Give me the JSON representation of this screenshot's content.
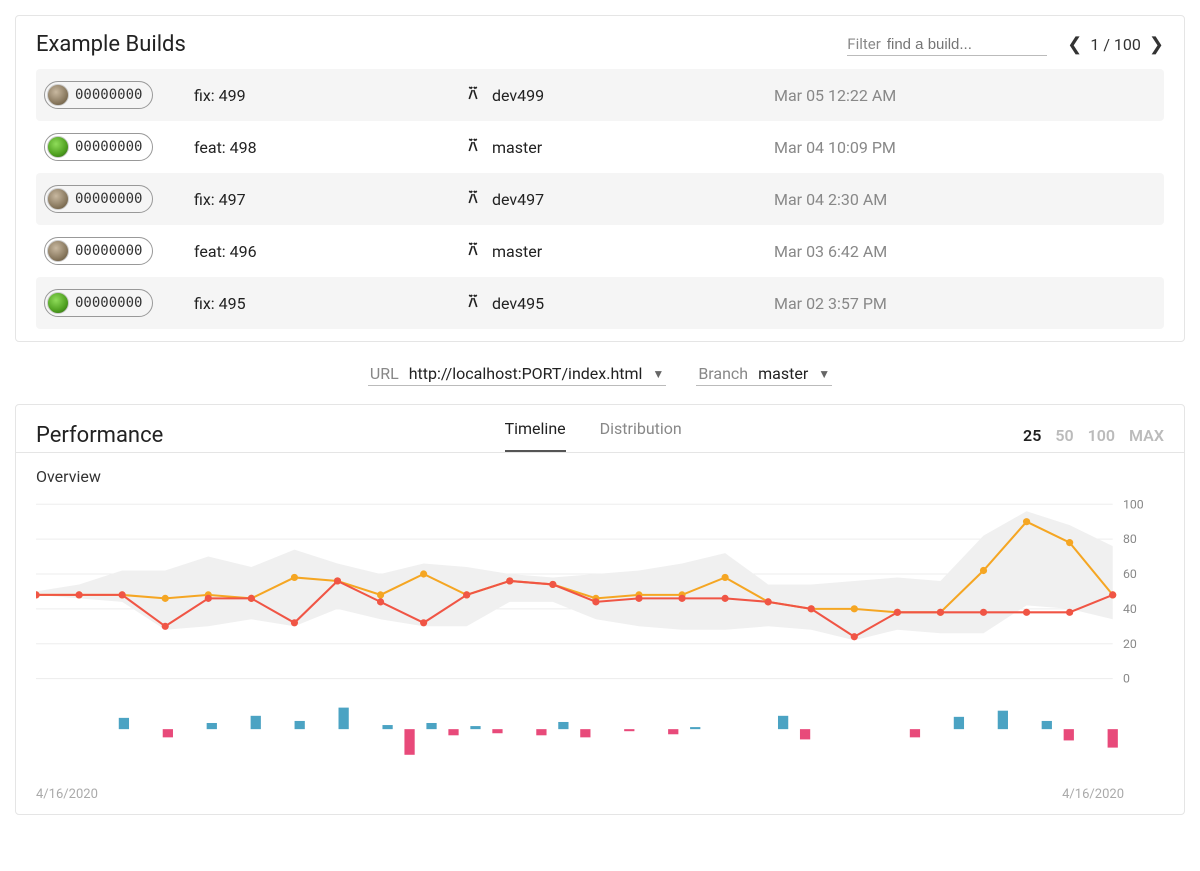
{
  "builds_card": {
    "title": "Example Builds",
    "filter_label": "Filter",
    "filter_placeholder": "find a build...",
    "pager_text": "1 / 100",
    "pager_current": 1,
    "pager_total": 100
  },
  "builds": [
    {
      "hash": "00000000",
      "avatar": "tan",
      "message": "fix: 499",
      "branch": "dev499",
      "time": "Mar 05 12:22 AM"
    },
    {
      "hash": "00000000",
      "avatar": "green",
      "message": "feat: 498",
      "branch": "master",
      "time": "Mar 04 10:09 PM"
    },
    {
      "hash": "00000000",
      "avatar": "tan",
      "message": "fix: 497",
      "branch": "dev497",
      "time": "Mar 04 2:30 AM"
    },
    {
      "hash": "00000000",
      "avatar": "tan",
      "message": "feat: 496",
      "branch": "master",
      "time": "Mar 03 6:42 AM"
    },
    {
      "hash": "00000000",
      "avatar": "green",
      "message": "fix: 495",
      "branch": "dev495",
      "time": "Mar 02 3:57 PM"
    }
  ],
  "selectors": {
    "url_label": "URL",
    "url_value": "http://localhost:PORT/index.html",
    "branch_label": "Branch",
    "branch_value": "master"
  },
  "perf_card": {
    "title": "Performance",
    "tabs": [
      "Timeline",
      "Distribution"
    ],
    "active_tab": "Timeline",
    "range_options": [
      "25",
      "50",
      "100",
      "MAX"
    ],
    "active_range": "25",
    "overview_label": "Overview",
    "date_left": "4/16/2020",
    "date_right": "4/16/2020"
  },
  "chart_data": {
    "overview_line": {
      "type": "line",
      "title": "Overview",
      "xlabel": "",
      "ylabel": "",
      "ylim": [
        0,
        100
      ],
      "y_ticks": [
        0,
        20,
        40,
        60,
        80,
        100
      ],
      "x_count": 25,
      "series": [
        {
          "name": "orange",
          "color": "#f5a623",
          "values": [
            48,
            48,
            48,
            46,
            48,
            46,
            58,
            56,
            48,
            60,
            48,
            56,
            54,
            46,
            48,
            48,
            58,
            44,
            40,
            40,
            38,
            38,
            62,
            90,
            78,
            48
          ]
        },
        {
          "name": "red",
          "color": "#f05545",
          "values": [
            48,
            48,
            48,
            30,
            46,
            46,
            32,
            56,
            44,
            32,
            48,
            56,
            54,
            44,
            46,
            46,
            46,
            44,
            40,
            24,
            38,
            38,
            38,
            38,
            38,
            48
          ]
        }
      ],
      "band": {
        "lower": [
          48,
          46,
          44,
          28,
          30,
          34,
          30,
          40,
          34,
          30,
          30,
          44,
          44,
          34,
          30,
          28,
          28,
          30,
          28,
          22,
          28,
          26,
          26,
          42,
          40,
          34
        ],
        "upper": [
          50,
          54,
          62,
          62,
          70,
          64,
          74,
          66,
          60,
          66,
          64,
          60,
          58,
          60,
          62,
          66,
          72,
          54,
          54,
          56,
          58,
          56,
          82,
          96,
          88,
          76
        ]
      }
    },
    "diff_bars": {
      "type": "bar",
      "baseline": 0,
      "x_count": 25,
      "series": [
        {
          "name": "blue",
          "color": "#4ba3c3",
          "values": [
            0,
            0,
            0,
            0,
            11,
            0,
            0,
            0,
            6,
            0,
            13,
            0,
            8,
            0,
            21,
            0,
            4,
            0,
            6,
            0,
            3,
            0,
            0,
            0,
            7,
            0,
            0,
            0,
            0,
            0,
            2,
            0,
            0,
            0,
            13,
            0,
            0,
            0,
            0,
            0,
            0,
            0,
            12,
            0,
            18,
            0,
            8,
            0,
            0,
            0
          ]
        },
        {
          "name": "pink",
          "color": "#e84a7a",
          "values": [
            0,
            0,
            0,
            0,
            0,
            0,
            -8,
            0,
            0,
            0,
            0,
            0,
            0,
            0,
            0,
            0,
            0,
            -25,
            0,
            -6,
            0,
            -4,
            0,
            -6,
            0,
            -8,
            0,
            -2,
            0,
            -5,
            0,
            0,
            0,
            0,
            0,
            -10,
            0,
            0,
            0,
            0,
            -8,
            0,
            0,
            0,
            0,
            0,
            0,
            -11,
            0,
            -18
          ]
        }
      ]
    }
  }
}
